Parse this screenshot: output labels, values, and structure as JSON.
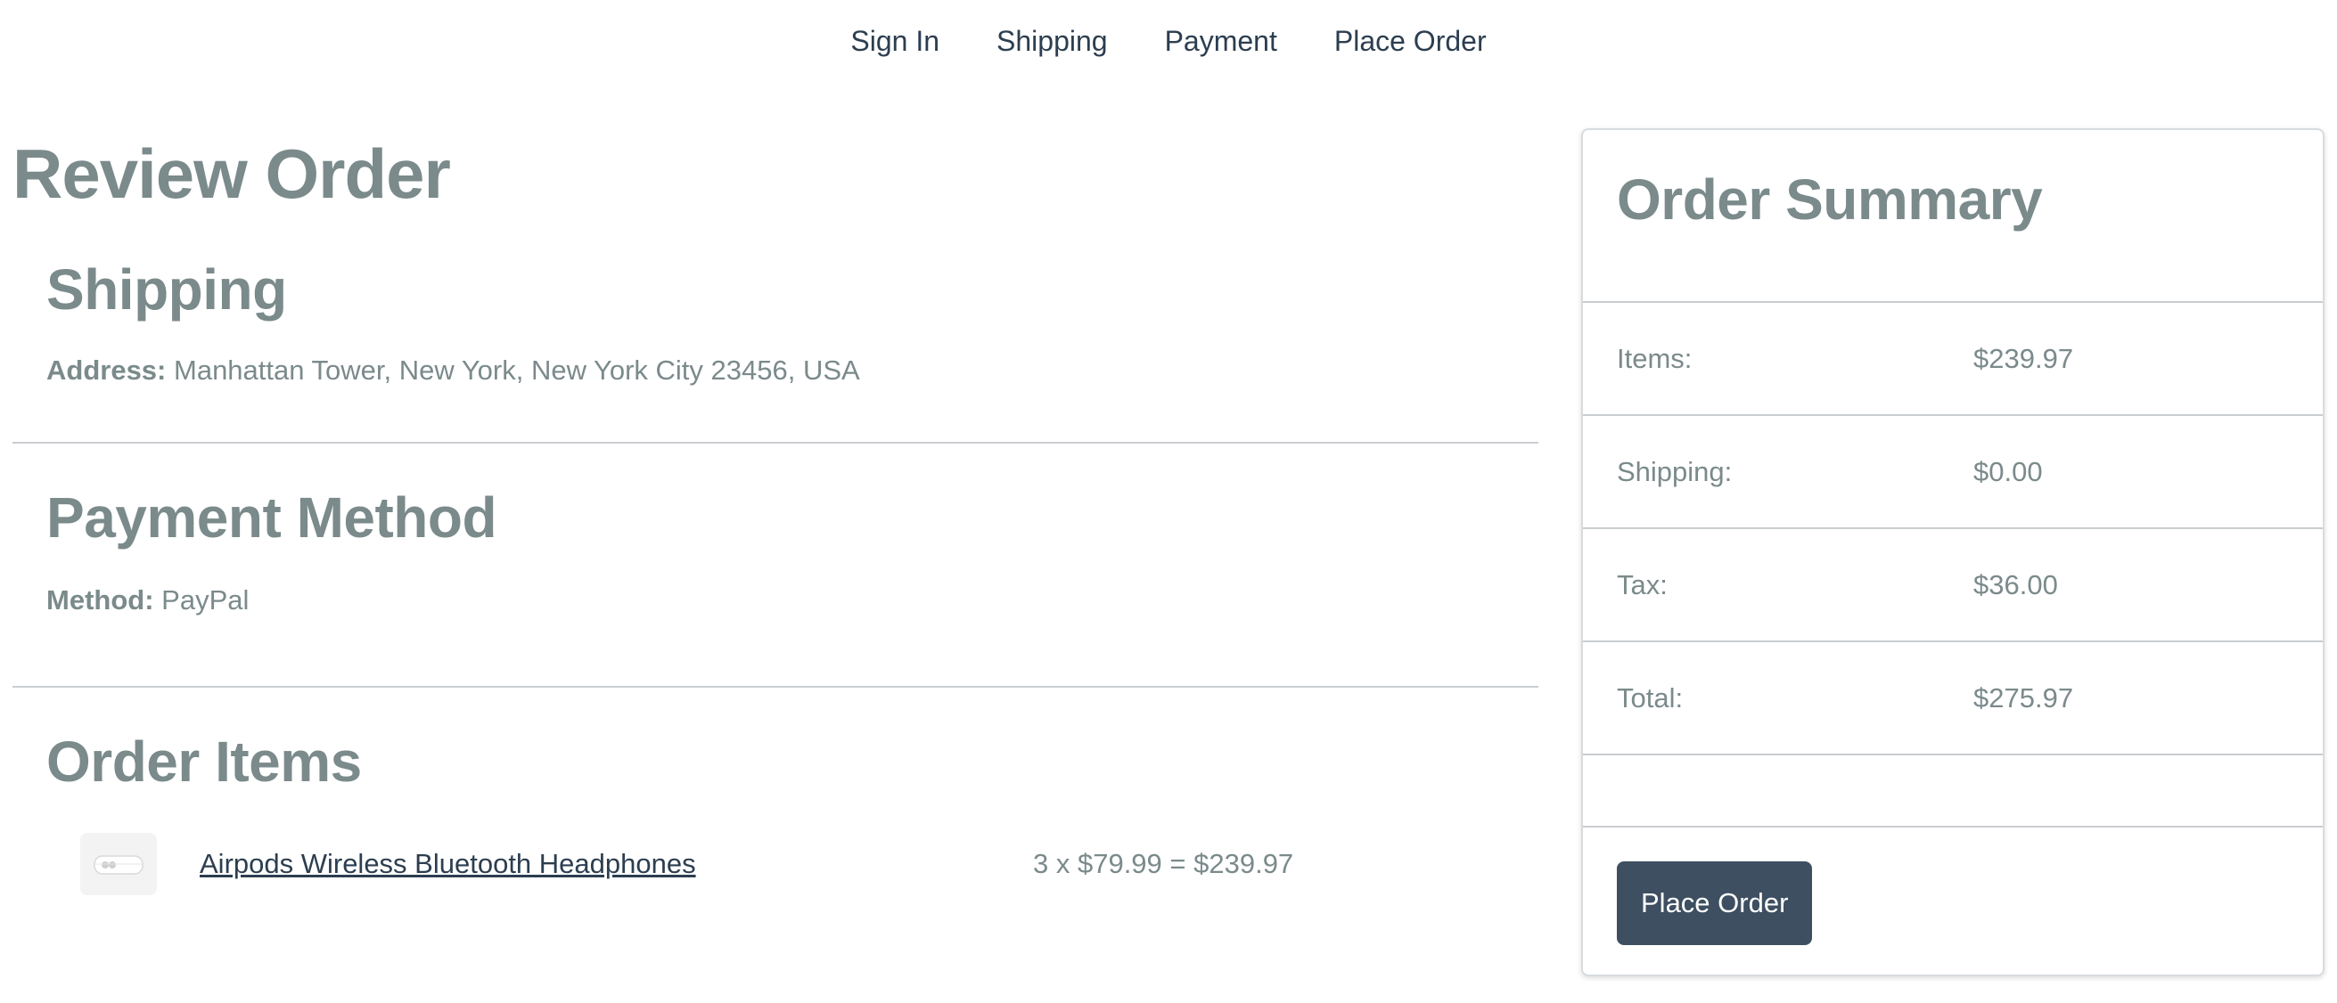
{
  "checkout_steps": [
    "Sign In",
    "Shipping",
    "Payment",
    "Place Order"
  ],
  "page_title": "Review Order",
  "shipping": {
    "heading": "Shipping",
    "address_label": "Address:",
    "address_value": "Manhattan Tower, New York, New York City 23456, USA"
  },
  "payment": {
    "heading": "Payment Method",
    "method_label": "Method:",
    "method_value": "PayPal"
  },
  "order_items": {
    "heading": "Order Items",
    "items": [
      {
        "name": "Airpods Wireless Bluetooth Headphones",
        "calc": "3 x $79.99 = $239.97",
        "icon": "airpods-thumbnail"
      }
    ]
  },
  "summary": {
    "heading": "Order Summary",
    "rows": [
      {
        "label": "Items:",
        "value": "$239.97"
      },
      {
        "label": "Shipping:",
        "value": "$0.00"
      },
      {
        "label": "Tax:",
        "value": "$36.00"
      },
      {
        "label": "Total:",
        "value": "$275.97"
      }
    ],
    "button_label": "Place Order"
  },
  "colors": {
    "text_muted": "#7b8a8b",
    "link": "#2c3e50",
    "button_bg": "#3d4f60",
    "button_text": "#ffffff"
  }
}
